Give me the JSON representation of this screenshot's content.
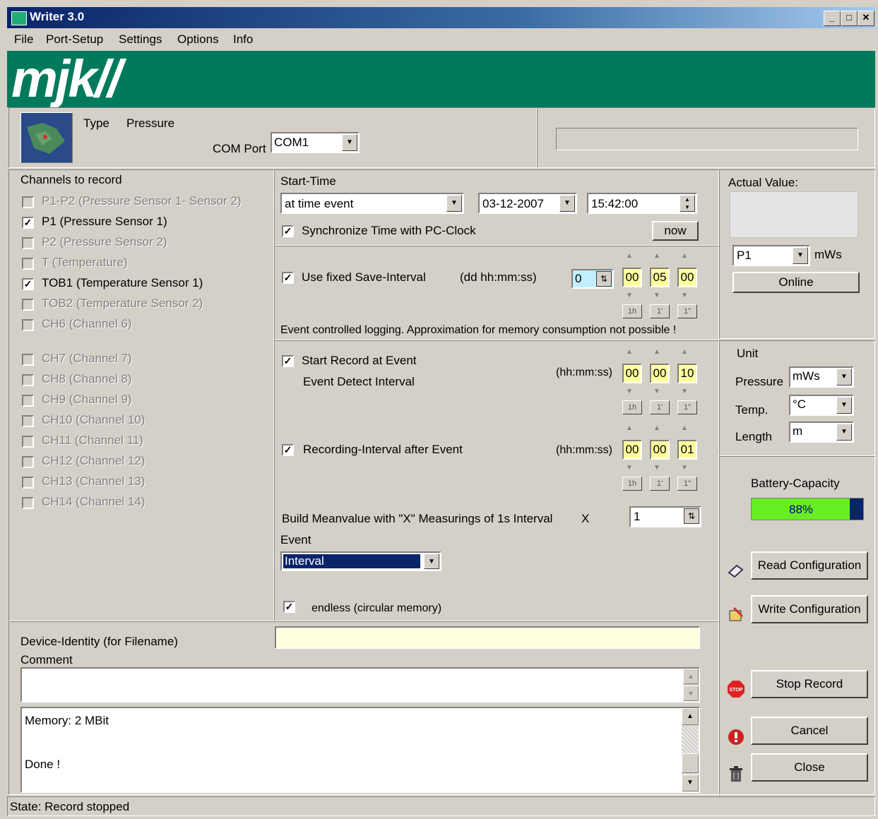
{
  "window": {
    "title": "Writer 3.0"
  },
  "menu": [
    "File",
    "Port-Setup",
    "Settings",
    "Options",
    "Info"
  ],
  "banner": {
    "logo": "mjk//"
  },
  "device": {
    "type_label": "Type",
    "type_value": "Pressure",
    "com_label": "COM Port",
    "com_value": "COM1"
  },
  "channels": {
    "title": "Channels to record",
    "items": [
      {
        "label": "P1-P2 (Pressure Sensor 1- Sensor 2)",
        "checked": false,
        "enabled": false
      },
      {
        "label": "P1 (Pressure Sensor 1)",
        "checked": true,
        "enabled": true
      },
      {
        "label": "P2 (Pressure Sensor 2)",
        "checked": false,
        "enabled": false
      },
      {
        "label": "T (Temperature)",
        "checked": false,
        "enabled": false
      },
      {
        "label": "TOB1 (Temperature Sensor 1)",
        "checked": true,
        "enabled": true
      },
      {
        "label": "TOB2 (Temperature Sensor 2)",
        "checked": false,
        "enabled": false
      },
      {
        "label": "CH6 (Channel 6)",
        "checked": false,
        "enabled": false
      },
      {
        "label": "CH7 (Channel 7)",
        "checked": false,
        "enabled": false
      },
      {
        "label": "CH8 (Channel 8)",
        "checked": false,
        "enabled": false
      },
      {
        "label": "CH9 (Channel 9)",
        "checked": false,
        "enabled": false
      },
      {
        "label": "CH10 (Channel 10)",
        "checked": false,
        "enabled": false
      },
      {
        "label": "CH11 (Channel 11)",
        "checked": false,
        "enabled": false
      },
      {
        "label": "CH12 (Channel 12)",
        "checked": false,
        "enabled": false
      },
      {
        "label": "CH13 (Channel 13)",
        "checked": false,
        "enabled": false
      },
      {
        "label": "CH14 (Channel 14)",
        "checked": false,
        "enabled": false
      }
    ]
  },
  "start": {
    "title": "Start-Time",
    "mode": "at time event",
    "date": "03-12-2007",
    "time": "15:42:00",
    "sync_label": "Synchronize Time with PC-Clock",
    "sync_checked": true,
    "now_label": "now"
  },
  "save_interval": {
    "label": "Use fixed Save-Interval",
    "format": "(dd hh:mm:ss)",
    "days": "0",
    "hh": "00",
    "mm": "05",
    "ss": "00",
    "checked": true,
    "note": "Event controlled logging. Approximation for memory consumption not possible !"
  },
  "event": {
    "start_label": "Start Record at Event",
    "start_checked": true,
    "detect_label": "Event Detect Interval",
    "detect_format": "(hh:mm:ss)",
    "detect": {
      "hh": "00",
      "mm": "00",
      "ss": "10"
    },
    "rec_label": "Recording-Interval after Event",
    "rec_checked": true,
    "rec_format": "(hh:mm:ss)",
    "rec": {
      "hh": "00",
      "mm": "00",
      "ss": "01"
    },
    "mean_label": "Build Meanvalue with \"X\" Measurings of 1s Interval",
    "mean_x": "X",
    "mean_value": "1",
    "event_label": "Event",
    "event_value": "Interval",
    "endless_label": "endless (circular memory)",
    "endless_checked": true,
    "btn_1h": "1h",
    "btn_1m": "1'",
    "btn_1s": "1\""
  },
  "actual": {
    "title": "Actual Value:",
    "channel": "P1",
    "unit": "mWs",
    "online_label": "Online"
  },
  "units": {
    "title": "Unit",
    "pressure_label": "Pressure",
    "pressure": "mWs",
    "temp_label": "Temp.",
    "temp": "°C",
    "length_label": "Length",
    "length": "m"
  },
  "battery": {
    "title": "Battery-Capacity",
    "percent": 88,
    "text": "88%"
  },
  "actions": {
    "read": "Read Configuration",
    "write": "Write Configuration",
    "stop": "Stop Record",
    "cancel": "Cancel",
    "close": "Close",
    "stop_icon_text": "STOP"
  },
  "identity": {
    "label": "Device-Identity (for Filename)",
    "value": ""
  },
  "comment": {
    "label": "Comment",
    "value": ""
  },
  "log": {
    "line1": "Memory: 2 MBit",
    "line2": "Done !"
  },
  "status": {
    "text": "State: Record stopped"
  }
}
